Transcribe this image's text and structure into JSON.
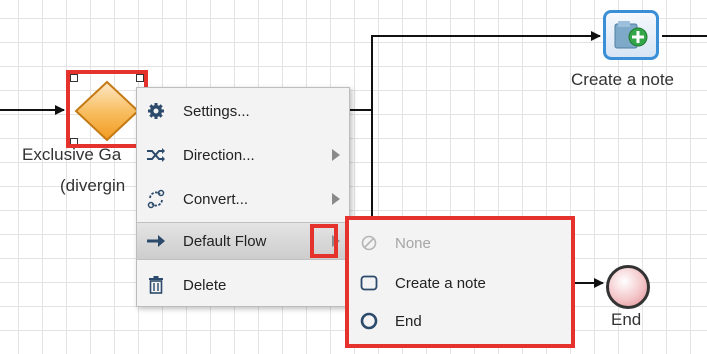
{
  "colors": {
    "highlight": "#e5322c",
    "gateway_fill": "#f6a72f",
    "task_border": "#3b8fd6",
    "end_fill": "#f4c6c9",
    "flow_line": "#111111"
  },
  "canvas": {
    "gateway": {
      "label_line1": "Exclusive Ga",
      "label_line2": "(divergin",
      "icon": "exclusive-gateway-diamond-icon"
    },
    "task": {
      "label": "Create a note",
      "icon": "folder-plus-icon"
    },
    "end_event": {
      "label": "End",
      "icon": "end-event-circle-icon"
    }
  },
  "context_menu": {
    "items": [
      {
        "label": "Settings...",
        "icon": "gear-icon",
        "has_submenu": false
      },
      {
        "label": "Direction...",
        "icon": "shuffle-icon",
        "has_submenu": true
      },
      {
        "label": "Convert...",
        "icon": "convert-icon",
        "has_submenu": true
      },
      {
        "label": "Default Flow",
        "icon": "arrow-right-icon",
        "has_submenu": true,
        "active": true
      },
      {
        "label": "Delete",
        "icon": "trash-icon",
        "has_submenu": false
      }
    ]
  },
  "default_flow_submenu": {
    "items": [
      {
        "label": "None",
        "icon": "none-circle-slash-icon",
        "disabled": true
      },
      {
        "label": "Create a note",
        "icon": "task-rectangle-icon",
        "disabled": false
      },
      {
        "label": "End",
        "icon": "end-circle-icon",
        "disabled": false
      }
    ]
  }
}
